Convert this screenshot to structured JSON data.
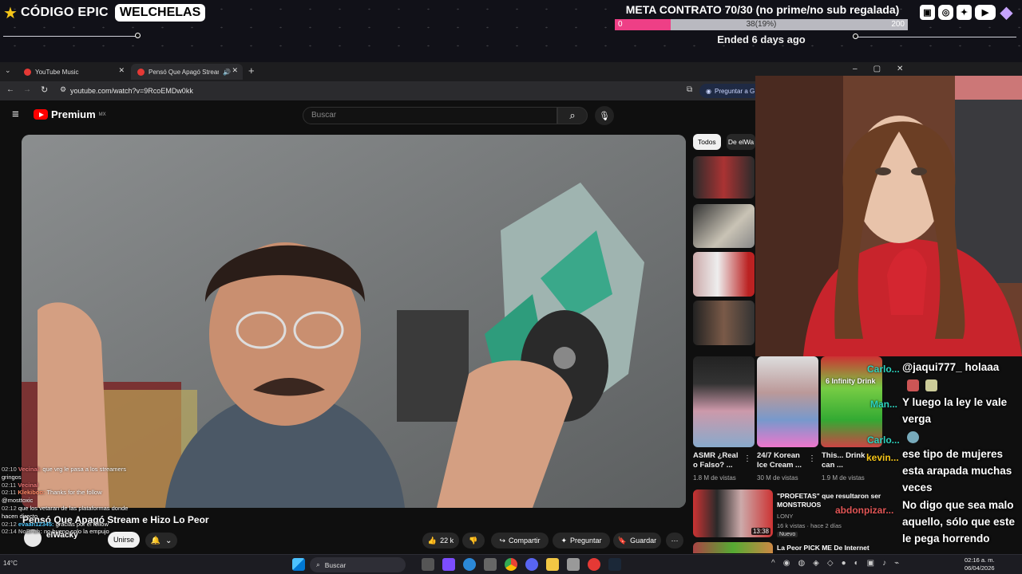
{
  "overlay": {
    "brand_name": "CÓDIGO EPIC",
    "brand_badge": "WELCHELAS",
    "meta_title": "META CONTRATO 70/30 (no prime/no sub regalada)",
    "meta_min": "0",
    "meta_progress_label": "38(19%)",
    "meta_max": "200",
    "meta_progress_fraction": 0.19,
    "meta_status": "Ended 6 days ago",
    "accent_color": "#ee3f86",
    "socials": [
      "twitch-icon",
      "instagram-icon",
      "twitter-icon",
      "youtube-icon",
      "kick-gem-icon"
    ]
  },
  "browser": {
    "tabs": [
      {
        "label": "YouTube Music"
      },
      {
        "label": "Pensó Que Apagó Stream e"
      }
    ],
    "url": "youtube.com/watch?v=9RcoEMDw0kk",
    "ask_label": "Preguntar a G"
  },
  "youtube": {
    "logo_text": "Premium",
    "logo_region": "MX",
    "search_placeholder": "Buscar",
    "video_title": "Pensó Que Apagó Stream e Hizo Lo Peor",
    "channel_name": "elWacky",
    "join_label": "Unirse",
    "likes": "22 k",
    "share_label": "Compartir",
    "ask_label": "Preguntar",
    "save_label": "Guardar",
    "chips": [
      "Todos",
      "De elWa"
    ],
    "shorts": [
      {
        "title": "ASMR ¿Real o Falso? ...",
        "views": "1.8 M de vistas"
      },
      {
        "title": "24/7 Korean Ice Cream ...",
        "views": "30 M de vistas"
      },
      {
        "title": "This... Drink can ...",
        "views": "1.9 M de vistas",
        "overlay_text": "6 Infinity Drink"
      }
    ],
    "recommended": [
      {
        "title": "\"PROFETAS\" que resultaron ser MONSTRUOS",
        "channel": "LONY",
        "meta": "16 k vistas · hace 2 días",
        "badge": "Nuevo",
        "duration": "13:38"
      },
      {
        "title": "La Peor PICK ME De Internet"
      }
    ]
  },
  "window_controls": [
    "–",
    "▢",
    "✕"
  ],
  "webcam": {
    "label": "Streamer webcam"
  },
  "stream_chat": [
    {
      "user": "@jaqui777_",
      "text": "holaaa"
    },
    {
      "user": "",
      "text": "Y luego la ley le vale verga"
    },
    {
      "user": "",
      "text": "ese tipo de mujeres esta arapada muchas veces"
    },
    {
      "user": "",
      "text": "No digo que sea malo aquello, sólo que este le pega horrendo"
    }
  ],
  "overlay_usernames": [
    "Carlo...",
    "Man...",
    "Carlo...",
    "kevin...",
    "abdonpizar..."
  ],
  "left_chat": [
    {
      "time": "02:10",
      "user": "Vecinal:",
      "text": "que vrg le pasa a los streamers gringos"
    },
    {
      "time": "02:11",
      "user": "Vecinal",
      "text": ""
    },
    {
      "time": "02:11",
      "user": "Klekiboo:",
      "text": "Thanks for the follow @mosttoxic"
    },
    {
      "time": "02:12",
      "user": "",
      "text": "que los vetaran de las plataformas donde hacen directo"
    },
    {
      "time": "02:12",
      "user": "evaan12345:",
      "text": "gracias por el follow"
    },
    {
      "time": "02:14",
      "user": "NoBruh:",
      "text": "no bueno solo la empujo"
    }
  ],
  "taskbar": {
    "search_label": "Buscar",
    "weather": "14°C",
    "time": "02:16 a. m.",
    "date": "06/04/2026"
  }
}
